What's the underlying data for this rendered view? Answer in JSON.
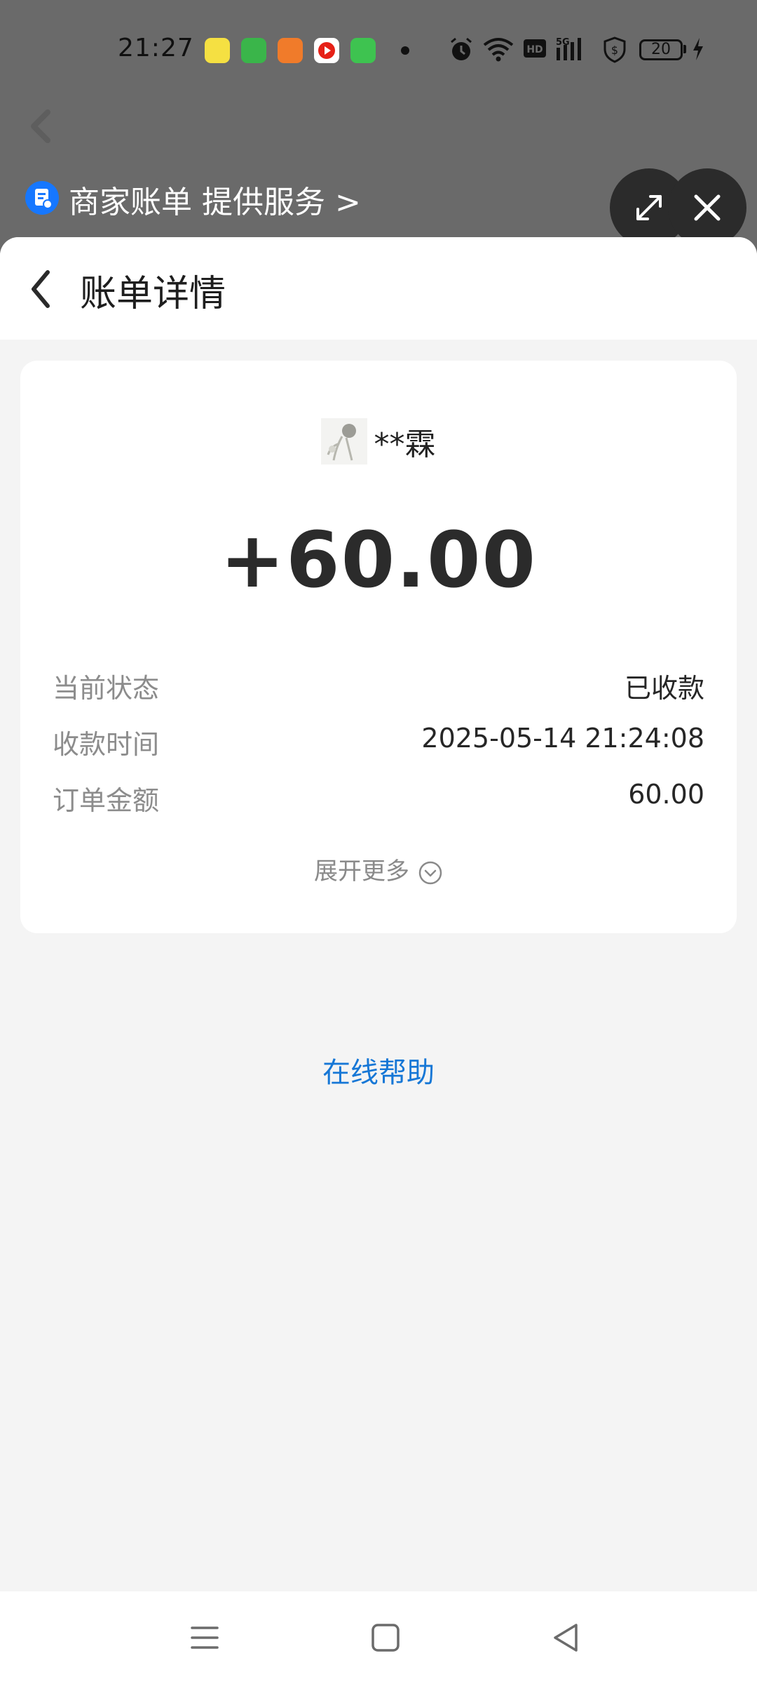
{
  "status_bar": {
    "time": "21:27",
    "battery": "20",
    "notification_icons": [
      "game-app-icon",
      "message-app-icon",
      "video-app-icon",
      "youtube-app-icon",
      "android-app-icon"
    ],
    "system_icons": [
      "alarm-icon",
      "wifi-icon",
      "hd-icon",
      "signal-5g-icon",
      "vpn-shield-icon",
      "battery-icon",
      "charging-icon"
    ]
  },
  "provider": {
    "text": "商家账单 提供服务 >"
  },
  "header": {
    "title": "账单详情"
  },
  "bill": {
    "payer_name": "**霖",
    "amount": "+60.00",
    "rows": [
      {
        "label": "当前状态",
        "value": "已收款"
      },
      {
        "label": "收款时间",
        "value": "2025-05-14 21:24:08"
      },
      {
        "label": "订单金额",
        "value": "60.00"
      }
    ],
    "expand_label": "展开更多"
  },
  "help": {
    "label": "在线帮助"
  },
  "colors": {
    "accent": "#1677d6",
    "backdrop": "#6a6a6a",
    "page_background": "#f4f4f4"
  }
}
